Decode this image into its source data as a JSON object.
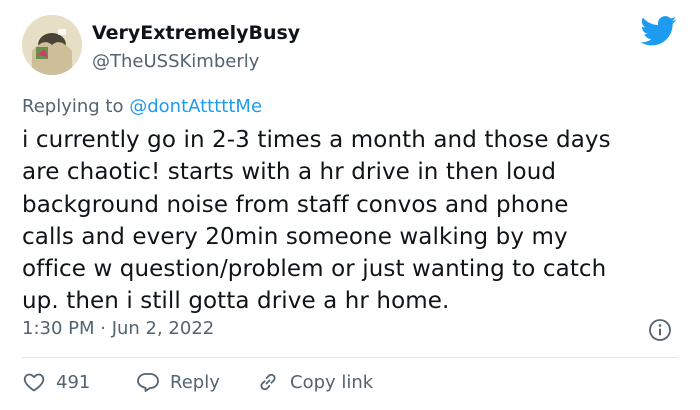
{
  "author": {
    "display_name": "VeryExtremelyBusy",
    "handle": "@TheUSSKimberly",
    "avatar_icon": "profile-photo",
    "platform_icon": "twitter-bird-icon",
    "platform_color": "#1d9bf0"
  },
  "reply": {
    "prefix": "Replying to",
    "mention": "@dontAtttttMe"
  },
  "tweet": {
    "lines": [
      "i currently go in 2-3 times a month and those days",
      "are chaotic! starts with a hr drive in then loud",
      "background noise from staff convos and phone",
      "calls and every 20min someone walking by my",
      "office w question/problem or just wanting to catch",
      "up. then i still gotta drive a hr home."
    ],
    "timestamp": "1:30 PM · Jun 2, 2022"
  },
  "actions": {
    "like_count": "491",
    "reply_label": "Reply",
    "copy_label": "Copy link"
  },
  "icons": {
    "info": "info-icon",
    "like": "heart-icon",
    "reply": "speech-bubble-icon",
    "copy": "link-icon"
  },
  "colors": {
    "text": "#0f1419",
    "secondary": "#536471",
    "link": "#1d9bf0",
    "divider": "#e1e8ed"
  }
}
